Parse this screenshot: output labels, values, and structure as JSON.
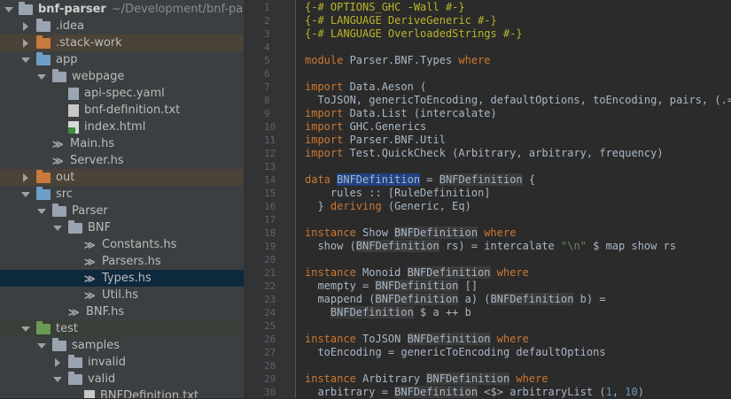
{
  "project": {
    "name": "bnf-parser",
    "path": "~/Development/bnf-parser"
  },
  "tree": [
    {
      "label": "bnf-parser",
      "icon": "folder-icon",
      "color": "grey",
      "indent": 0,
      "state": "open",
      "project": true
    },
    {
      "label": ".idea",
      "icon": "folder-icon",
      "color": "grey",
      "indent": 1,
      "state": "closed"
    },
    {
      "label": ".stack-work",
      "icon": "folder-icon",
      "color": "orange",
      "indent": 1,
      "state": "closed",
      "hl": "orange"
    },
    {
      "label": "app",
      "icon": "folder-icon",
      "color": "blue",
      "indent": 1,
      "state": "open"
    },
    {
      "label": "webpage",
      "icon": "folder-icon",
      "color": "grey",
      "indent": 2,
      "state": "open"
    },
    {
      "label": "api-spec.yaml",
      "icon": "yaml-file-icon",
      "color": "yaml",
      "indent": 3,
      "state": "none"
    },
    {
      "label": "bnf-definition.txt",
      "icon": "text-file-icon",
      "color": "txt",
      "indent": 3,
      "state": "none"
    },
    {
      "label": "index.html",
      "icon": "html-file-icon",
      "color": "html",
      "indent": 3,
      "state": "none"
    },
    {
      "label": "Main.hs",
      "icon": "haskell-file-icon",
      "color": "hs",
      "indent": 2,
      "state": "none"
    },
    {
      "label": "Server.hs",
      "icon": "haskell-file-icon",
      "color": "hs",
      "indent": 2,
      "state": "none"
    },
    {
      "label": "out",
      "icon": "folder-icon",
      "color": "orange",
      "indent": 1,
      "state": "closed",
      "hl": "orange"
    },
    {
      "label": "src",
      "icon": "folder-icon",
      "color": "blue",
      "indent": 1,
      "state": "open"
    },
    {
      "label": "Parser",
      "icon": "folder-icon",
      "color": "grey",
      "indent": 2,
      "state": "open"
    },
    {
      "label": "BNF",
      "icon": "folder-icon",
      "color": "grey",
      "indent": 3,
      "state": "open"
    },
    {
      "label": "Constants.hs",
      "icon": "haskell-file-icon",
      "color": "hs",
      "indent": 4,
      "state": "none"
    },
    {
      "label": "Parsers.hs",
      "icon": "haskell-file-icon",
      "color": "hs",
      "indent": 4,
      "state": "none"
    },
    {
      "label": "Types.hs",
      "icon": "haskell-file-icon",
      "color": "hs",
      "indent": 4,
      "state": "none",
      "selected": true
    },
    {
      "label": "Util.hs",
      "icon": "haskell-file-icon",
      "color": "hs",
      "indent": 4,
      "state": "none"
    },
    {
      "label": "BNF.hs",
      "icon": "haskell-file-icon",
      "color": "hs",
      "indent": 3,
      "state": "none"
    },
    {
      "label": "test",
      "icon": "folder-icon",
      "color": "green",
      "indent": 1,
      "state": "open",
      "hl": "green"
    },
    {
      "label": "samples",
      "icon": "folder-icon",
      "color": "grey",
      "indent": 2,
      "state": "open"
    },
    {
      "label": "invalid",
      "icon": "folder-icon",
      "color": "grey",
      "indent": 3,
      "state": "closed"
    },
    {
      "label": "valid",
      "icon": "folder-icon",
      "color": "grey",
      "indent": 3,
      "state": "open"
    },
    {
      "label": "BNFDefinition.txt",
      "icon": "text-file-icon",
      "color": "txt",
      "indent": 4,
      "state": "none"
    }
  ],
  "editor": {
    "lines": [
      {
        "n": "1",
        "segs": [
          {
            "t": "{-# OPTIONS_GHC -Wall #-}",
            "c": "t-pragma"
          }
        ]
      },
      {
        "n": "2",
        "segs": [
          {
            "t": "{-# LANGUAGE DeriveGeneric #-}",
            "c": "t-pragma"
          }
        ]
      },
      {
        "n": "3",
        "segs": [
          {
            "t": "{-# LANGUAGE OverloadedStrings #-}",
            "c": "t-pragma"
          }
        ]
      },
      {
        "n": "4",
        "segs": []
      },
      {
        "n": "5",
        "segs": [
          {
            "t": "module ",
            "c": "t-kw"
          },
          {
            "t": "Parser.BNF.Types ",
            "c": "t-mod"
          },
          {
            "t": "where",
            "c": "t-kw"
          }
        ]
      },
      {
        "n": "6",
        "segs": []
      },
      {
        "n": "7",
        "segs": [
          {
            "t": "import ",
            "c": "t-kw"
          },
          {
            "t": "Data.Aeson (",
            "c": "t-mod"
          }
        ]
      },
      {
        "n": "8",
        "segs": [
          {
            "t": "  ToJSON, genericToEncoding, defaultOptions, toEncoding, pairs, (.=))",
            "c": "t-mod"
          }
        ]
      },
      {
        "n": "9",
        "segs": [
          {
            "t": "import ",
            "c": "t-kw"
          },
          {
            "t": "Data.List (intercalate)",
            "c": "t-mod"
          }
        ]
      },
      {
        "n": "10",
        "segs": [
          {
            "t": "import ",
            "c": "t-kw"
          },
          {
            "t": "GHC.Generics",
            "c": "t-mod"
          }
        ]
      },
      {
        "n": "11",
        "segs": [
          {
            "t": "import ",
            "c": "t-kw"
          },
          {
            "t": "Parser.BNF.Util",
            "c": "t-mod"
          }
        ]
      },
      {
        "n": "12",
        "segs": [
          {
            "t": "import ",
            "c": "t-kw"
          },
          {
            "t": "Test.QuickCheck (Arbitrary, arbitrary, frequency)",
            "c": "t-mod"
          }
        ]
      },
      {
        "n": "13",
        "segs": []
      },
      {
        "n": "14",
        "segs": [
          {
            "t": "data ",
            "c": "t-kw"
          },
          {
            "t": "BNFDefinition",
            "c": "t-sel"
          },
          {
            "t": " = ",
            "c": "t-ty"
          },
          {
            "t": "BNFDefinition",
            "c": "t-hl"
          },
          {
            "t": " {",
            "c": "t-ty"
          }
        ]
      },
      {
        "n": "15",
        "segs": [
          {
            "t": "    rules :: [RuleDefinition]",
            "c": "t-ty"
          }
        ]
      },
      {
        "n": "16",
        "segs": [
          {
            "t": "  } ",
            "c": "t-ty"
          },
          {
            "t": "deriving ",
            "c": "t-kw"
          },
          {
            "t": "(Generic, Eq)",
            "c": "t-ty"
          }
        ]
      },
      {
        "n": "17",
        "segs": []
      },
      {
        "n": "18",
        "segs": [
          {
            "t": "instance ",
            "c": "t-kw"
          },
          {
            "t": "Show ",
            "c": "t-ty"
          },
          {
            "t": "BNFDefinition",
            "c": "t-hl"
          },
          {
            "t": " where",
            "c": "t-kw"
          }
        ]
      },
      {
        "n": "19",
        "segs": [
          {
            "t": "  show (",
            "c": "t-ty"
          },
          {
            "t": "BNFDefinition",
            "c": "t-hl"
          },
          {
            "t": " rs) = intercalate ",
            "c": "t-ty"
          },
          {
            "t": "\"\\n\"",
            "c": "t-str"
          },
          {
            "t": " $ map show rs",
            "c": "t-ty"
          }
        ]
      },
      {
        "n": "20",
        "segs": []
      },
      {
        "n": "21",
        "segs": [
          {
            "t": "instance ",
            "c": "t-kw"
          },
          {
            "t": "Monoid ",
            "c": "t-ty"
          },
          {
            "t": "BNFDefinition",
            "c": "t-hl"
          },
          {
            "t": " where",
            "c": "t-kw"
          }
        ]
      },
      {
        "n": "22",
        "segs": [
          {
            "t": "  mempty = ",
            "c": "t-ty"
          },
          {
            "t": "BNFDefinition",
            "c": "t-hl"
          },
          {
            "t": " []",
            "c": "t-ty"
          }
        ]
      },
      {
        "n": "23",
        "segs": [
          {
            "t": "  mappend (",
            "c": "t-ty"
          },
          {
            "t": "BNFDefinition",
            "c": "t-hl"
          },
          {
            "t": " a) (",
            "c": "t-ty"
          },
          {
            "t": "BNFDefinition",
            "c": "t-hl"
          },
          {
            "t": " b) =",
            "c": "t-ty"
          }
        ]
      },
      {
        "n": "24",
        "segs": [
          {
            "t": "    ",
            "c": "t-ty"
          },
          {
            "t": "BNFDefinition",
            "c": "t-hl"
          },
          {
            "t": " $ a ++ b",
            "c": "t-ty"
          }
        ]
      },
      {
        "n": "25",
        "segs": []
      },
      {
        "n": "26",
        "segs": [
          {
            "t": "instance ",
            "c": "t-kw"
          },
          {
            "t": "ToJSON ",
            "c": "t-ty"
          },
          {
            "t": "BNFDefinition",
            "c": "t-hl"
          },
          {
            "t": " where",
            "c": "t-kw"
          }
        ]
      },
      {
        "n": "27",
        "segs": [
          {
            "t": "  toEncoding = genericToEncoding defaultOptions",
            "c": "t-ty"
          }
        ]
      },
      {
        "n": "28",
        "segs": []
      },
      {
        "n": "29",
        "segs": [
          {
            "t": "instance ",
            "c": "t-kw"
          },
          {
            "t": "Arbitrary ",
            "c": "t-ty"
          },
          {
            "t": "BNFDefinition",
            "c": "t-hl"
          },
          {
            "t": " where",
            "c": "t-kw"
          }
        ]
      },
      {
        "n": "30",
        "segs": [
          {
            "t": "  arbitrary = ",
            "c": "t-ty"
          },
          {
            "t": "BNFDefinition",
            "c": "t-hl"
          },
          {
            "t": " <$> arbitraryList (",
            "c": "t-ty"
          },
          {
            "t": "1",
            "c": "t-num"
          },
          {
            "t": ", ",
            "c": "t-ty"
          },
          {
            "t": "10",
            "c": "t-num"
          },
          {
            "t": ")",
            "c": "t-ty"
          }
        ]
      }
    ]
  }
}
